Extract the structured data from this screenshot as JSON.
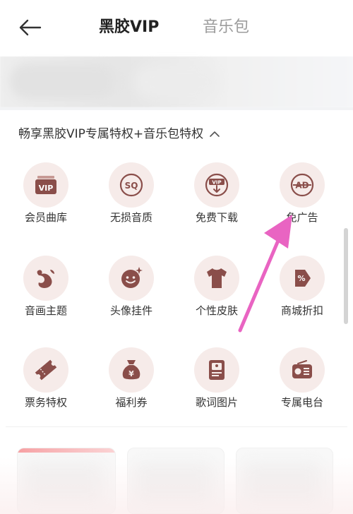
{
  "header": {
    "tabs": [
      {
        "label": "黑胶VIP",
        "active": true
      },
      {
        "label": "音乐包",
        "active": false
      }
    ]
  },
  "section": {
    "title": "畅享黑胶VIP专属特权+音乐包特权"
  },
  "privileges": [
    {
      "label": "会员曲库",
      "icon": "vip-library-icon"
    },
    {
      "label": "无损音质",
      "icon": "sq-lossless-icon"
    },
    {
      "label": "免费下载",
      "icon": "vip-download-icon"
    },
    {
      "label": "免广告",
      "icon": "ad-free-icon"
    },
    {
      "label": "音画主题",
      "icon": "theme-whale-icon"
    },
    {
      "label": "头像挂件",
      "icon": "avatar-pendant-icon"
    },
    {
      "label": "个性皮肤",
      "icon": "tshirt-skin-icon"
    },
    {
      "label": "商城折扣",
      "icon": "discount-tag-icon"
    },
    {
      "label": "票务特权",
      "icon": "ticket-icon"
    },
    {
      "label": "福利券",
      "icon": "money-bag-icon"
    },
    {
      "label": "歌词图片",
      "icon": "lyrics-card-icon"
    },
    {
      "label": "专属电台",
      "icon": "radio-icon"
    }
  ],
  "colors": {
    "icon_bg": "#f6ebe9",
    "icon_fg": "#8a4e4a",
    "annotation_arrow": "#e964c2",
    "inactive_tab": "#9c9c9c"
  }
}
